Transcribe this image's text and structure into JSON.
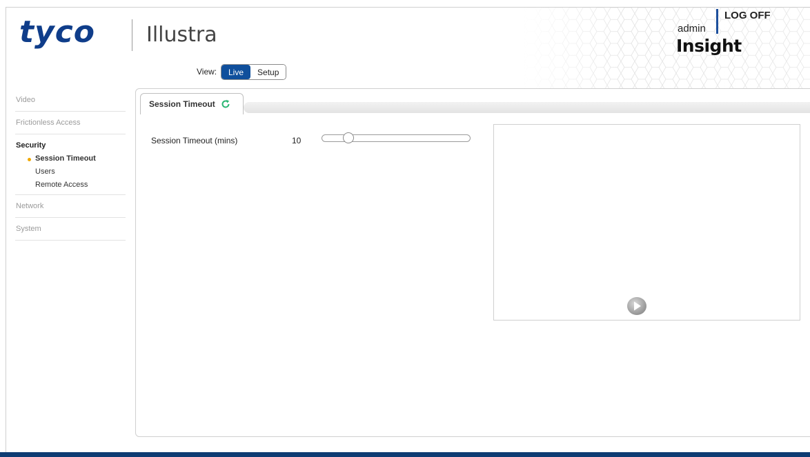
{
  "header": {
    "brand": "tyco",
    "subbrand": "Illustra",
    "user": "admin",
    "logoff_label": "LOG OFF",
    "product": "Insight"
  },
  "view": {
    "label": "View:",
    "live_label": "Live",
    "setup_label": "Setup",
    "active": "Live"
  },
  "sidebar": {
    "sections": [
      {
        "label": "Video"
      },
      {
        "label": "Frictionless Access"
      },
      {
        "label": "Security",
        "active": true,
        "items": [
          {
            "label": "Session Timeout",
            "selected": true
          },
          {
            "label": "Users"
          },
          {
            "label": "Remote Access"
          }
        ]
      },
      {
        "label": "Network"
      },
      {
        "label": "System"
      }
    ]
  },
  "tab": {
    "label": "Session Timeout"
  },
  "session_timeout": {
    "label": "Session Timeout (mins)",
    "value": "10",
    "slider_fraction": 0.15
  },
  "colors": {
    "brand_blue": "#0f3d8a",
    "live_button": "#0f4f9c",
    "selected_dot": "#f0a800",
    "refresh_icon": "#2bb673",
    "footer_bar": "#0e3c73"
  },
  "icons": {
    "tab_refresh": "refresh-icon",
    "video_play": "play-icon"
  }
}
